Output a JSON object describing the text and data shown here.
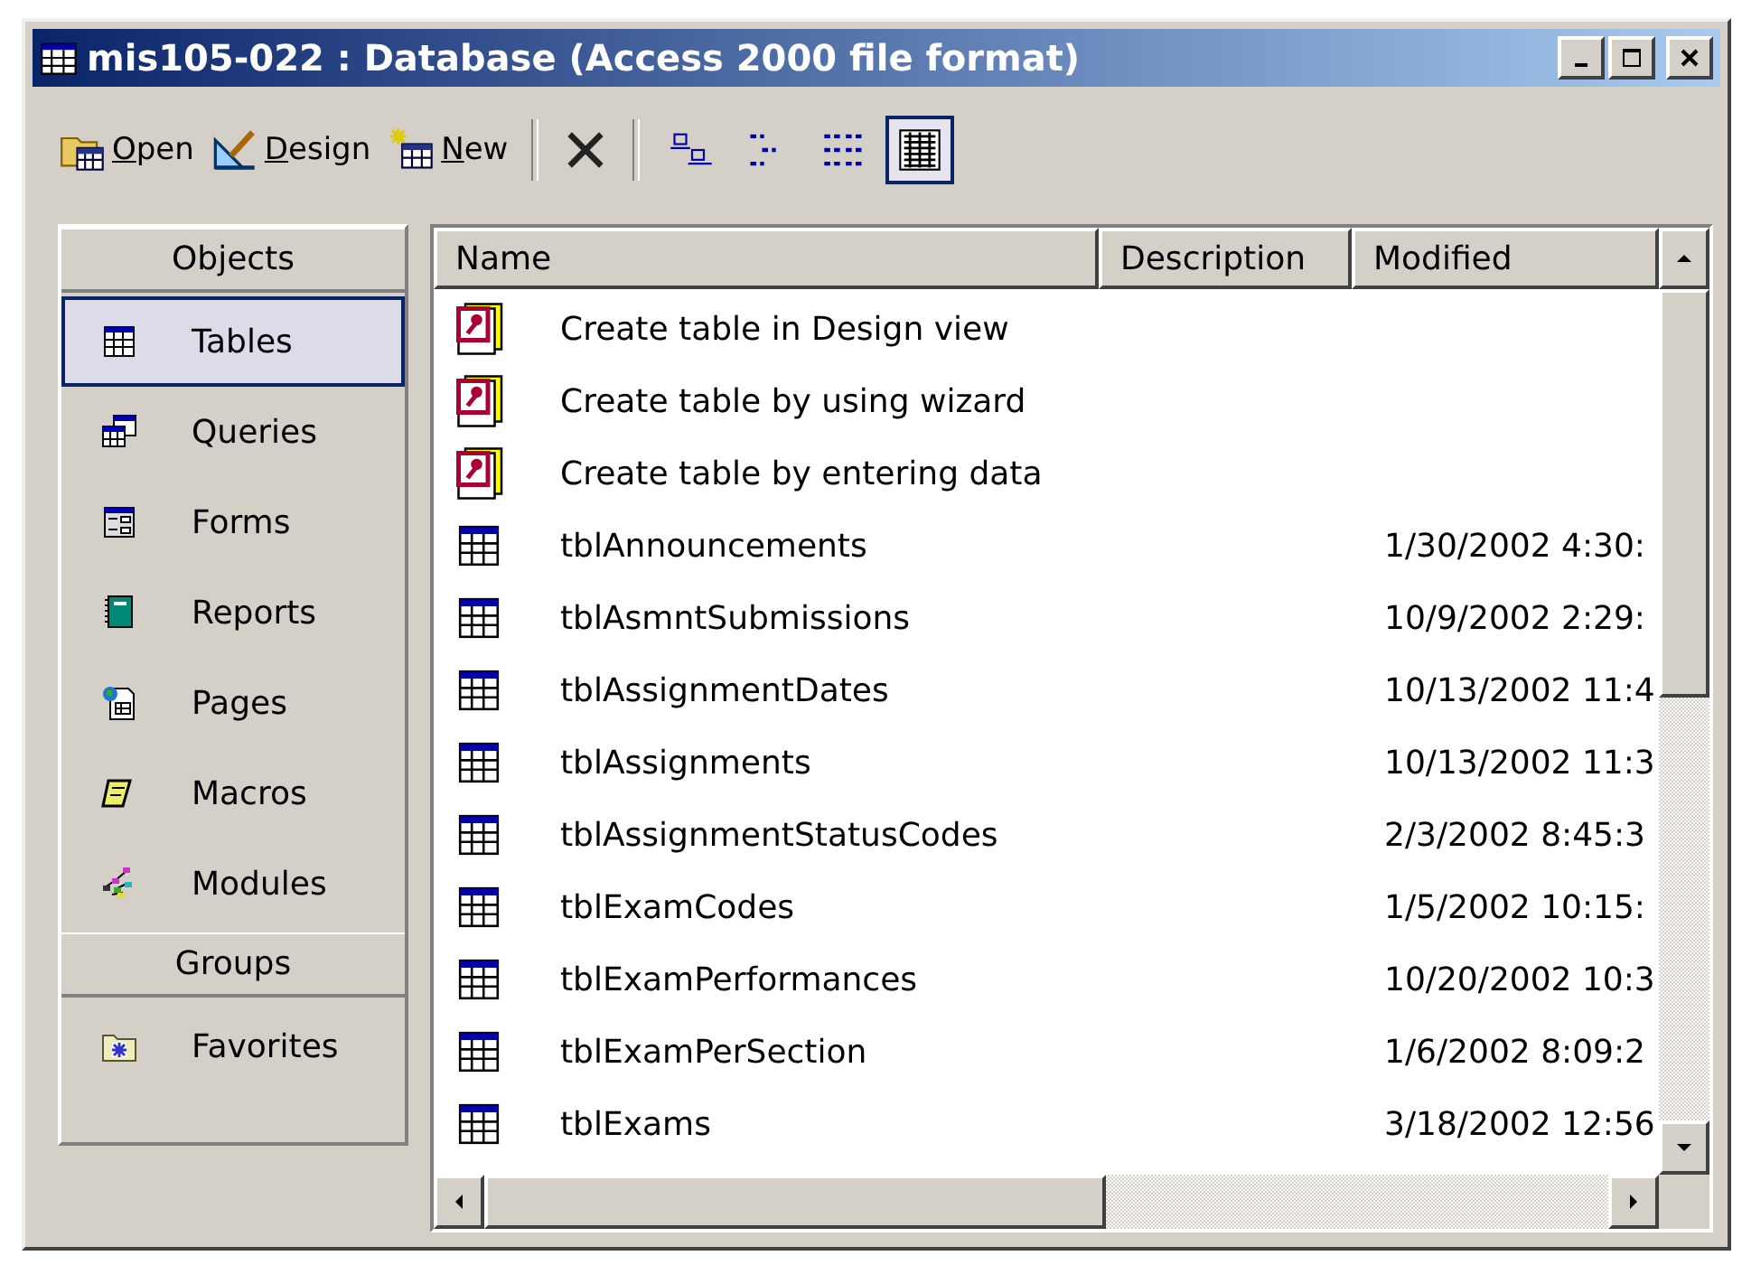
{
  "window": {
    "title": "mis105-022 : Database (Access 2000 file format)"
  },
  "toolbar": {
    "commands": [
      {
        "kind": "open",
        "label": "Open"
      },
      {
        "kind": "design",
        "label": "Design"
      },
      {
        "kind": "new",
        "label": "New"
      }
    ],
    "views": [
      {
        "kind": "large",
        "selected": false
      },
      {
        "kind": "small",
        "selected": false
      },
      {
        "kind": "list",
        "selected": false
      },
      {
        "kind": "details",
        "selected": true
      }
    ]
  },
  "sidebar": {
    "sections": [
      {
        "header": "Objects",
        "items": [
          {
            "kind": "tables",
            "label": "Tables",
            "selected": true
          },
          {
            "kind": "queries",
            "label": "Queries",
            "selected": false
          },
          {
            "kind": "forms",
            "label": "Forms",
            "selected": false
          },
          {
            "kind": "reports",
            "label": "Reports",
            "selected": false
          },
          {
            "kind": "pages",
            "label": "Pages",
            "selected": false
          },
          {
            "kind": "macros",
            "label": "Macros",
            "selected": false
          },
          {
            "kind": "modules",
            "label": "Modules",
            "selected": false
          }
        ]
      },
      {
        "header": "Groups",
        "items": [
          {
            "kind": "favorites",
            "label": "Favorites",
            "selected": false
          }
        ]
      }
    ]
  },
  "list": {
    "columns": [
      "Name",
      "Description",
      "Modified"
    ],
    "rows": [
      {
        "kind": "shortcut",
        "name": "Create table in Design view"
      },
      {
        "kind": "shortcut",
        "name": "Create table by using wizard"
      },
      {
        "kind": "shortcut",
        "name": "Create table by entering data"
      },
      {
        "kind": "table",
        "name": "tblAnnouncements",
        "modified": "1/30/2002 4:30:"
      },
      {
        "kind": "table",
        "name": "tblAsmntSubmissions",
        "modified": "10/9/2002 2:29:"
      },
      {
        "kind": "table",
        "name": "tblAssignmentDates",
        "modified": "10/13/2002 11:4"
      },
      {
        "kind": "table",
        "name": "tblAssignments",
        "modified": "10/13/2002 11:3"
      },
      {
        "kind": "table",
        "name": "tblAssignmentStatusCodes",
        "modified": "2/3/2002 8:45:3"
      },
      {
        "kind": "table",
        "name": "tblExamCodes",
        "modified": "1/5/2002 10:15:"
      },
      {
        "kind": "table",
        "name": "tblExamPerformances",
        "modified": "10/20/2002 10:3"
      },
      {
        "kind": "table",
        "name": "tblExamPerSection",
        "modified": "1/6/2002 8:09:2"
      },
      {
        "kind": "table",
        "name": "tblExams",
        "modified": "3/18/2002 12:56"
      }
    ]
  }
}
